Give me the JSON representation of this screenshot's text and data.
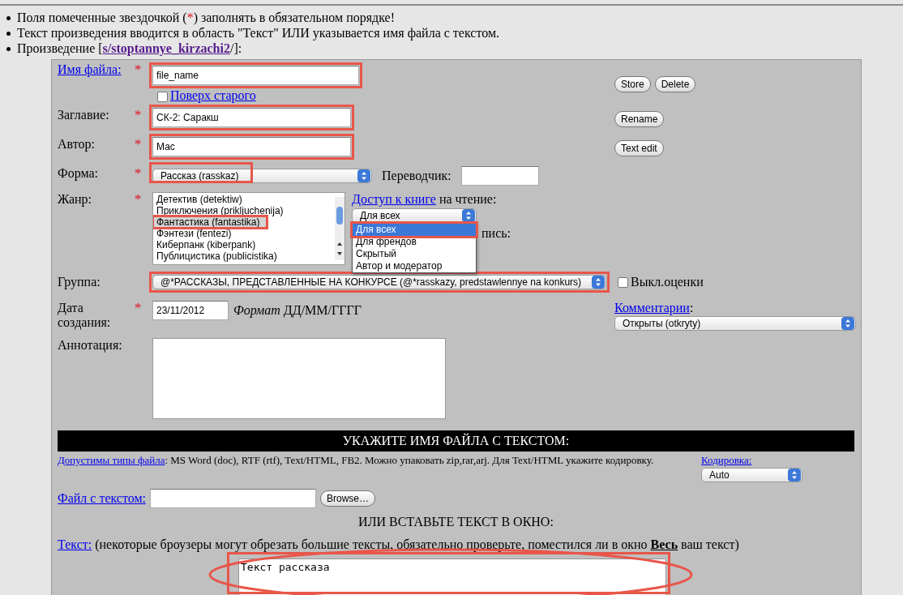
{
  "notes": [
    {
      "kind": "required",
      "before": "Поля помеченные звездочкой (",
      "mark": "*",
      "after": ") заполнять в обязательном порядке!"
    },
    {
      "kind": "plain",
      "text": "Текст произведения вводится в область \"Текст\" ИЛИ указывается имя файла с текстом."
    },
    {
      "kind": "work",
      "before": "Произведение [",
      "link": "s/stoptannye_kirzachi2",
      "after": "/]:"
    }
  ],
  "form": {
    "file_name": {
      "label": "Имя файла:",
      "required": true,
      "value": "file_name",
      "highlighted": true,
      "overwrite": {
        "label": "Поверх старого",
        "checked": false
      },
      "buttons": [
        "Store",
        "Delete"
      ]
    },
    "title": {
      "label": "Заглавие:",
      "required": true,
      "value": "СК-2: Саракш",
      "highlighted": true,
      "buttons": [
        "Rename"
      ]
    },
    "author": {
      "label": "Автор:",
      "required": true,
      "value": "Мас",
      "highlighted": true,
      "buttons": [
        "Text edit"
      ]
    },
    "form_type": {
      "label": "Форма:",
      "required": true,
      "value": "Рассказ (rasskaz)",
      "highlighted": true
    },
    "translator": {
      "label": "Переводчик:"
    },
    "genre": {
      "label": "Жанр:",
      "required": true,
      "highlighted": true,
      "options": [
        {
          "label": "Детектив (detektiw)",
          "selected": false
        },
        {
          "label": "Приключения (prikljuchenija)",
          "selected": false
        },
        {
          "label": "Фантастика (fantastika)",
          "selected": true
        },
        {
          "label": "Фэнтези (fentezi)",
          "selected": false
        },
        {
          "label": "Киберпанк (kiberpank)",
          "selected": false
        },
        {
          "label": "Публицистика (publicistika)",
          "selected": false
        }
      ]
    },
    "read_access": {
      "link": "Доступ к книге",
      "text": "на чтение:",
      "value": "Для всех",
      "highlighted": true,
      "options": [
        {
          "label": "Для всех",
          "selected": true
        },
        {
          "label": "Для френдов",
          "selected": false
        },
        {
          "label": "Скрытый",
          "selected": false
        },
        {
          "label": "Автор и модератор",
          "selected": false
        }
      ]
    },
    "write_access_fragment": "пись:",
    "group": {
      "label": "Группа:",
      "value": "@*РАССКАЗЫ, ПРЕДСТАВЛЕННЫЕ НА КОНКУРСЕ (@*rasskazy, predstawlennye na konkurs)",
      "highlighted": true
    },
    "ratings_off": {
      "label": "Выкл.оценки",
      "checked": false
    },
    "date": {
      "label": "Дата создания:",
      "required": true,
      "value": "23/11/2012",
      "format_label": "Формат",
      "format": "ДД/ММ/ГГГГ"
    },
    "comments": {
      "link": "Комментарии",
      "after": ":",
      "value": "Открыты (otkryty)"
    },
    "annotation": {
      "label": "Аннотация:"
    }
  },
  "upload": {
    "heading": "УКАЖИТЕ ИМЯ ФАЙЛА С ТЕКСТОМ:",
    "types_link": "Допустимы типы файла",
    "types_text": ": MS Word (doc), RTF (rtf), Text/HTML, FB2. Можно упаковать zip,rar,arj. Для Text/HTML укажите кодировку.",
    "encoding": {
      "link": "Кодировка:",
      "value": "Auto"
    },
    "file": {
      "link": "Файл с текстом:",
      "button": "Browse…"
    }
  },
  "paste": {
    "heading": "ИЛИ ВСТАВЬТЕ ТЕКСТ В ОКНО:",
    "link": "Текст:",
    "note": " (некоторые броузеры могут обрезать большие тексты, обязательно проверьте, поместился ли в окно **Весь** ваш текст)",
    "value": "Текст рассказа",
    "highlighted": true,
    "circled": true
  }
}
